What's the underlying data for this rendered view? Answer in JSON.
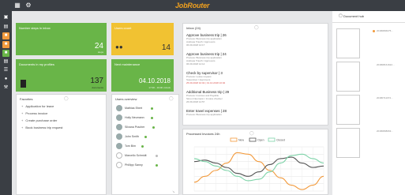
{
  "app": {
    "brand": "JobRouter"
  },
  "tiles": {
    "steps": {
      "title": "Number steps in inbox",
      "count": "24",
      "sub": "steps"
    },
    "users": {
      "title": "Users count",
      "count": "14"
    },
    "documents": {
      "title": "Documents in my profiles",
      "count": "137",
      "sub": "documents"
    },
    "maintenance": {
      "title": "Next maintenance",
      "date": "04.10.2018",
      "sub": "17:00 - 19:00 o'clock"
    }
  },
  "favorites": {
    "title": "Favorites",
    "items": [
      "Application for leave",
      "Process invoice",
      "Create purchase order",
      "Book business trip request"
    ]
  },
  "users_panel": {
    "title": "Users overview",
    "users": [
      {
        "name": "Mathias Ebert",
        "status": "online"
      },
      {
        "name": "Holly Neumann",
        "status": "online"
      },
      {
        "name": "Silvana Pracher",
        "status": "online"
      },
      {
        "name": "John Smith",
        "status": "online"
      },
      {
        "name": "Tom Bim",
        "status": "online"
      },
      {
        "name": "Marcello Schmidt",
        "status": "away"
      },
      {
        "name": "Phillipp Sanny",
        "status": "online"
      }
    ]
  },
  "inbox": {
    "title": "Inbox (24)",
    "items": [
      {
        "title": "Approve business trip | 26",
        "lines": [
          "Process: Business trip application",
          "Andreas Trauth / Approvers",
          "06.09.2018 14:17"
        ],
        "overdue": false
      },
      {
        "title": "Approve business trip | 24",
        "lines": [
          "Process: Business trip application",
          "Andreas Trauth / Approvers",
          "06.09.2018 14:14"
        ],
        "overdue": false
      },
      {
        "title": "Check by supervisor | 3",
        "lines": [
          "Process: Leave request",
          "Supervisor / Approvers",
          "25.09.2018 10:02 | 01.10.2018 10:02"
        ],
        "overdue": true
      },
      {
        "title": "Additional Business trip | 29",
        "lines": [
          "Process: Invoices and Payable",
          "Simon Neumann / Invoice checker",
          "26.09.2018 14:57"
        ],
        "overdue": false
      },
      {
        "title": "Enter travel expenses | 28",
        "lines": [
          "Process: Business trip application"
        ],
        "overdue": false
      }
    ]
  },
  "chart_card": {
    "title": "Processed Invoices 24h"
  },
  "chart_data": {
    "type": "line",
    "title": "Processed Invoices 24h",
    "series": [
      {
        "name": "New",
        "color": "#f29a3c",
        "values": [
          -18,
          -10,
          -2,
          8,
          22,
          20,
          10,
          -2,
          -12,
          -22,
          -28,
          -22,
          -10
        ]
      },
      {
        "name": "Open",
        "color": "#555555",
        "values": [
          10,
          12,
          8,
          2,
          -6,
          -10,
          -4,
          6,
          14,
          16,
          8,
          2,
          4
        ]
      },
      {
        "name": "Closed",
        "color": "#7dd3a8",
        "values": [
          14,
          10,
          4,
          -2,
          -10,
          -16,
          -14,
          -4,
          8,
          18,
          20,
          14,
          8
        ]
      }
    ],
    "ylim": [
      -30,
      30
    ],
    "grid": true,
    "legend": "top-center"
  },
  "documents_panel": {
    "title": "Document hub",
    "entries": [
      {
        "name": "20180806075..."
      },
      {
        "name": "201808161622..."
      },
      {
        "name": "20180711072..."
      },
      {
        "name": "20180808063..."
      }
    ]
  },
  "colors": {
    "green": "#69b548",
    "yellow": "#f1c232",
    "orange": "#f29a3c",
    "sidebar": "#3a3e44"
  }
}
